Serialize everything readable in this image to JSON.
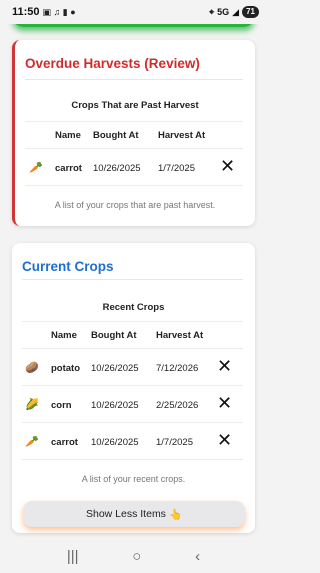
{
  "status_bar": {
    "time": "11:50",
    "signal": "5G",
    "battery": "71"
  },
  "overdue": {
    "title": "Overdue Harvests (Review)",
    "table_caption": "Crops That are Past Harvest",
    "columns": [
      "Name",
      "Bought At",
      "Harvest At"
    ],
    "rows": [
      {
        "icon": "carrot-icon",
        "glyph": "🥕",
        "name": "carrot",
        "bought": "10/26/2025",
        "harvest": "1/7/2025"
      }
    ],
    "footnote": "A list of your crops that are past harvest."
  },
  "current": {
    "title": "Current Crops",
    "table_caption": "Recent Crops",
    "columns": [
      "Name",
      "Bought At",
      "Harvest At"
    ],
    "rows": [
      {
        "icon": "potato-icon",
        "glyph": "🥔",
        "name": "potato",
        "bought": "10/26/2025",
        "harvest": "7/12/2026"
      },
      {
        "icon": "corn-icon",
        "glyph": "🌽",
        "name": "corn",
        "bought": "10/26/2025",
        "harvest": "2/25/2026"
      },
      {
        "icon": "carrot-icon",
        "glyph": "🥕",
        "name": "carrot",
        "bought": "10/26/2025",
        "harvest": "1/7/2025"
      }
    ],
    "footnote": "A list of your recent crops."
  },
  "show_less_button": {
    "label": "Show Less Items",
    "emoji": "👆"
  },
  "colors": {
    "overdue_accent": "#d12c2c",
    "current_accent": "#1e6fcf",
    "top_bar_accent": "#26b43f"
  }
}
